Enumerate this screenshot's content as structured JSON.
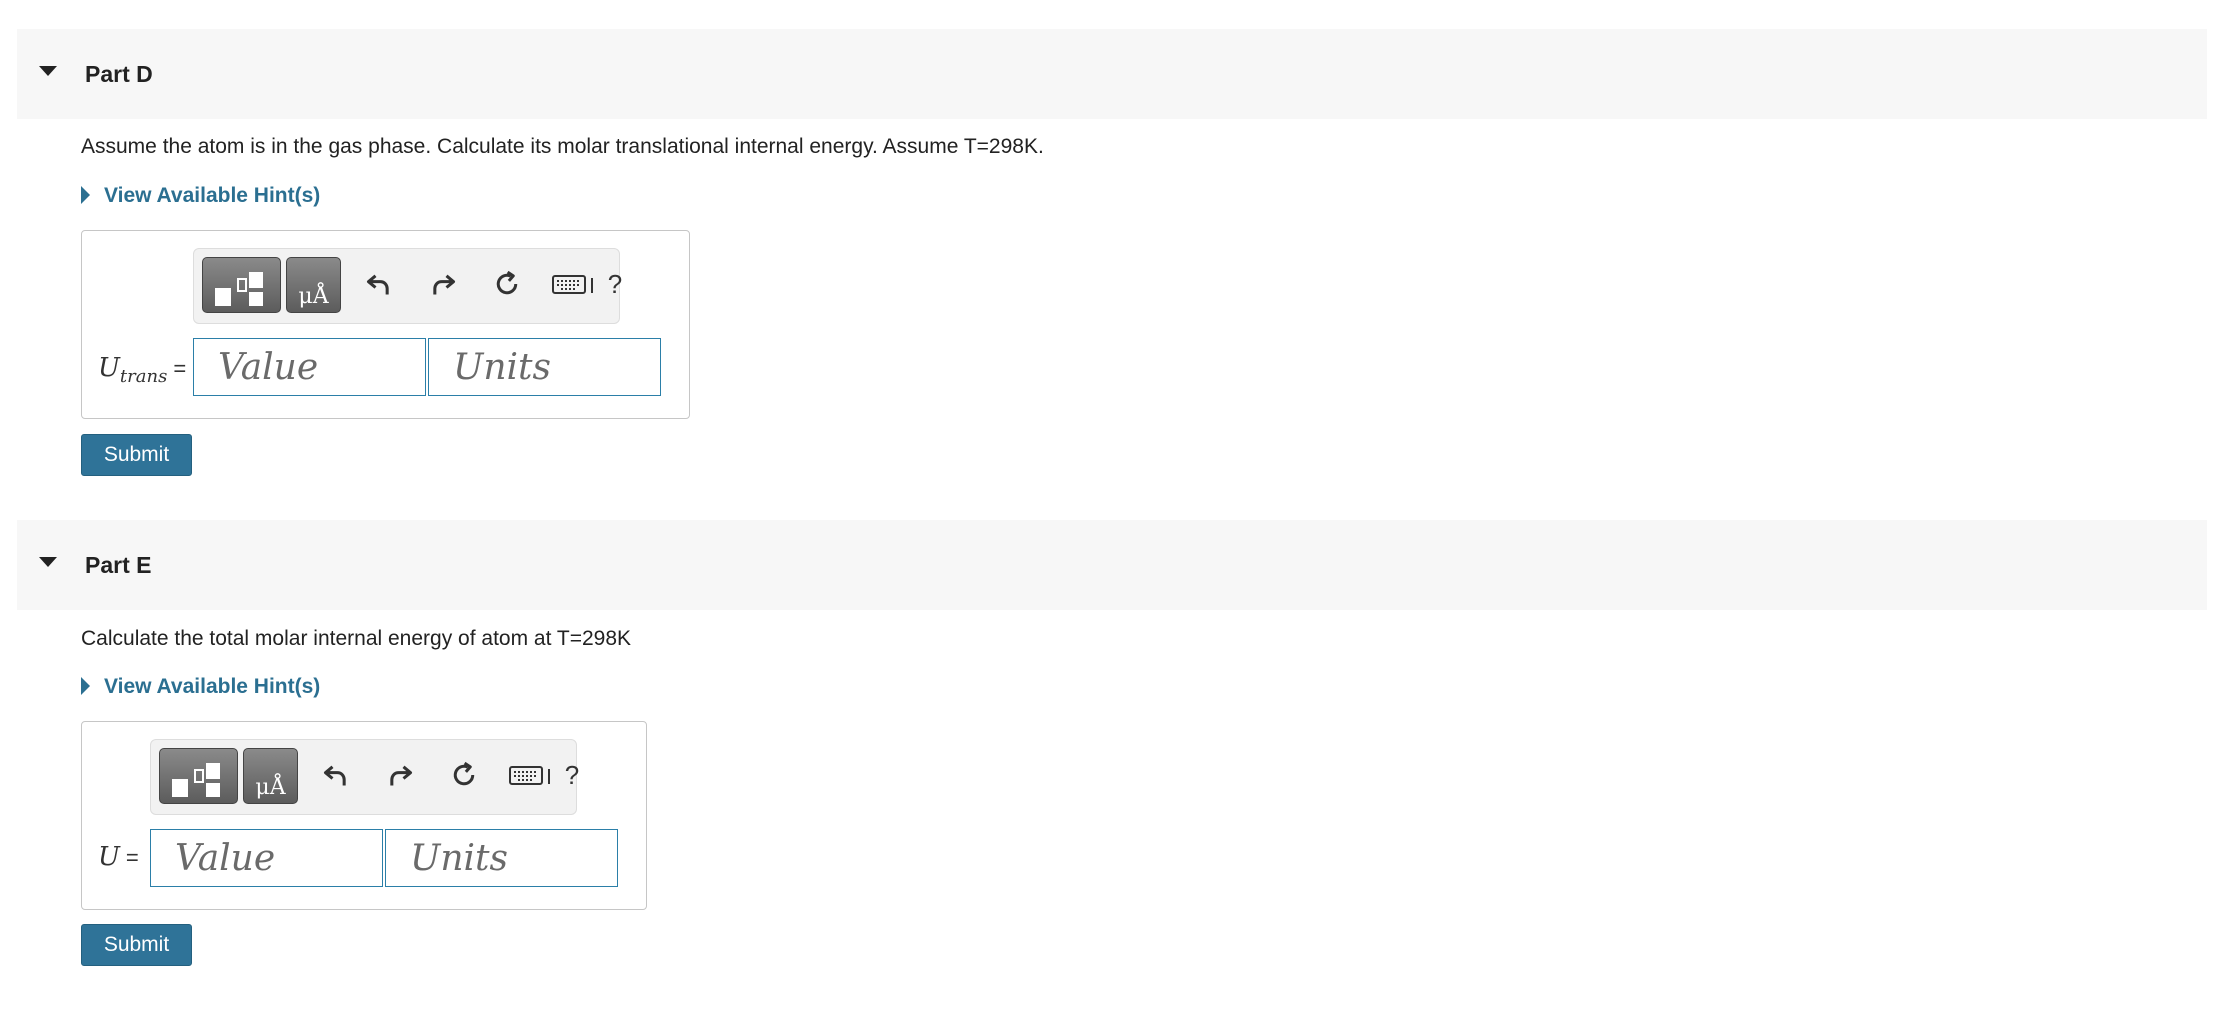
{
  "partD": {
    "title": "Part D",
    "question": "Assume the atom is in the gas phase. Calculate its molar translational internal energy. Assume T=298K.",
    "hint_label": "View Available Hint(s)",
    "label_var": "U",
    "label_sub": "trans",
    "label_eq": "=",
    "value_placeholder": "Value",
    "units_placeholder": "Units",
    "submit_label": "Submit"
  },
  "partE": {
    "title": "Part E",
    "question": "Calculate the total molar internal energy of atom at T=298K",
    "hint_label": "View Available Hint(s)",
    "label_var": "U",
    "label_eq": "=",
    "value_placeholder": "Value",
    "units_placeholder": "Units",
    "submit_label": "Submit"
  },
  "toolbar": {
    "units_glyph": "μÅ",
    "help_label": "?"
  },
  "colors": {
    "accent": "#2b6f91",
    "submit_bg": "#2f7398",
    "header_bg": "#f7f7f7"
  }
}
